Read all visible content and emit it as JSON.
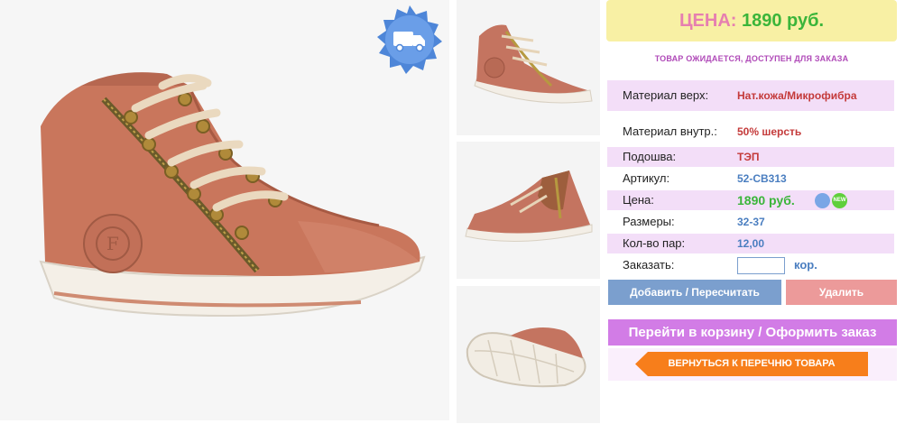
{
  "product": {
    "price_label": "ЦЕНА:",
    "price_value": "1890 руб.",
    "status": "товар ожидается, доступен для заказа",
    "badge_icon": "delivery-truck-icon",
    "specs": [
      {
        "label": "Материал верх:",
        "value": "Нат.кожа/Микрофибра"
      },
      {
        "label": "Материал внутр.:",
        "value": "50% шерсть"
      },
      {
        "label": "Подошва:",
        "value": "ТЭП"
      },
      {
        "label": "Артикул:",
        "value": "52-CB313"
      },
      {
        "label": "Цена:",
        "value": "1890 руб."
      },
      {
        "label": "Размеры:",
        "value": "32-37"
      },
      {
        "label": "Кол-во пар:",
        "value": "12,00"
      }
    ],
    "order_label": "Заказать:",
    "order_quantity": "",
    "order_unit": "кор."
  },
  "actions": {
    "add": "Добавить / Пересчитать",
    "delete": "Удалить",
    "cart": "Перейти в корзину / Оформить заказ",
    "back": "ВЕРНУТЬСЯ К ПЕРЕЧНЮ ТОВАРА"
  },
  "colors": {
    "price_bg": "#f8f0a4",
    "price_label": "#e67fb0",
    "price_value": "#3bb53a",
    "accent_purple": "#d27ce6",
    "accent_blue": "#7b9fce",
    "accent_pink": "#ec9a9a",
    "accent_orange": "#f77e1b"
  }
}
